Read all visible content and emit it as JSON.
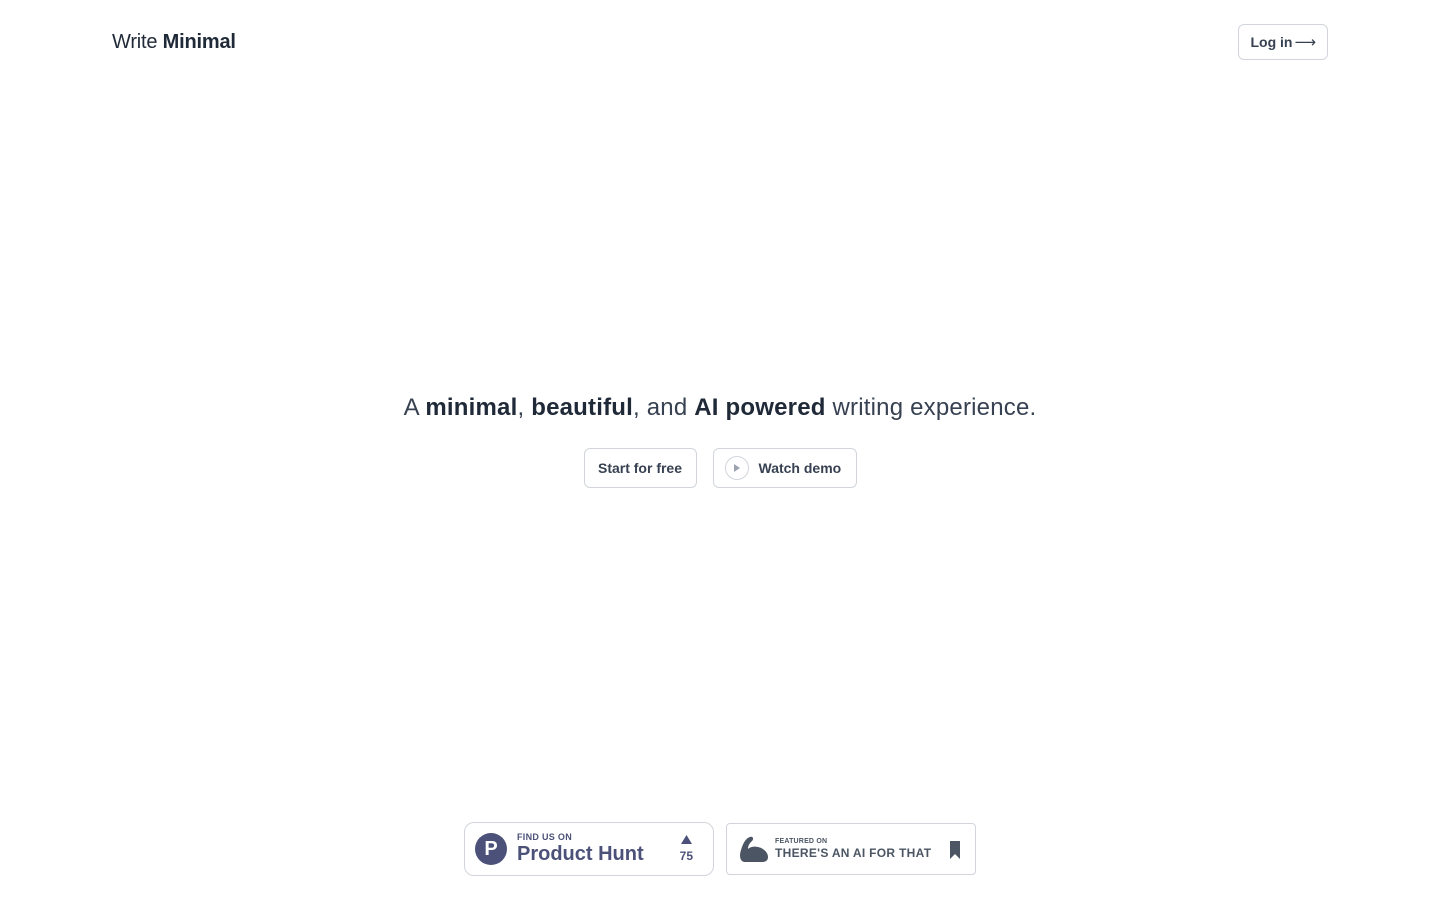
{
  "header": {
    "logo_prefix": "Write",
    "logo_bold": "Minimal",
    "login_label": "Log in",
    "login_arrow": "⟶"
  },
  "hero": {
    "tagline": {
      "part1": "A ",
      "bold1": "minimal",
      "part2": ", ",
      "bold2": "beautiful",
      "part3": ", and ",
      "bold3": "AI powered",
      "part4": " writing experience."
    },
    "start_label": "Start for free",
    "demo_label": "Watch demo"
  },
  "badges": {
    "product_hunt": {
      "logo_letter": "P",
      "small": "FIND US ON",
      "big": "Product Hunt",
      "votes": "75"
    },
    "taaft": {
      "small": "FEATURED ON",
      "big": "THERE'S AN AI FOR THAT"
    }
  },
  "colors": {
    "text": "#1f2937",
    "border": "#d1d5db",
    "product_hunt": "#4b5178",
    "taaft": "#4b5563"
  },
  "icons": {
    "login_arrow": "arrow-right-icon",
    "demo_play": "play-icon",
    "ph_upvote": "triangle-up-icon",
    "taaft_logo": "arm-icon",
    "taaft_bookmark": "bookmark-icon"
  }
}
